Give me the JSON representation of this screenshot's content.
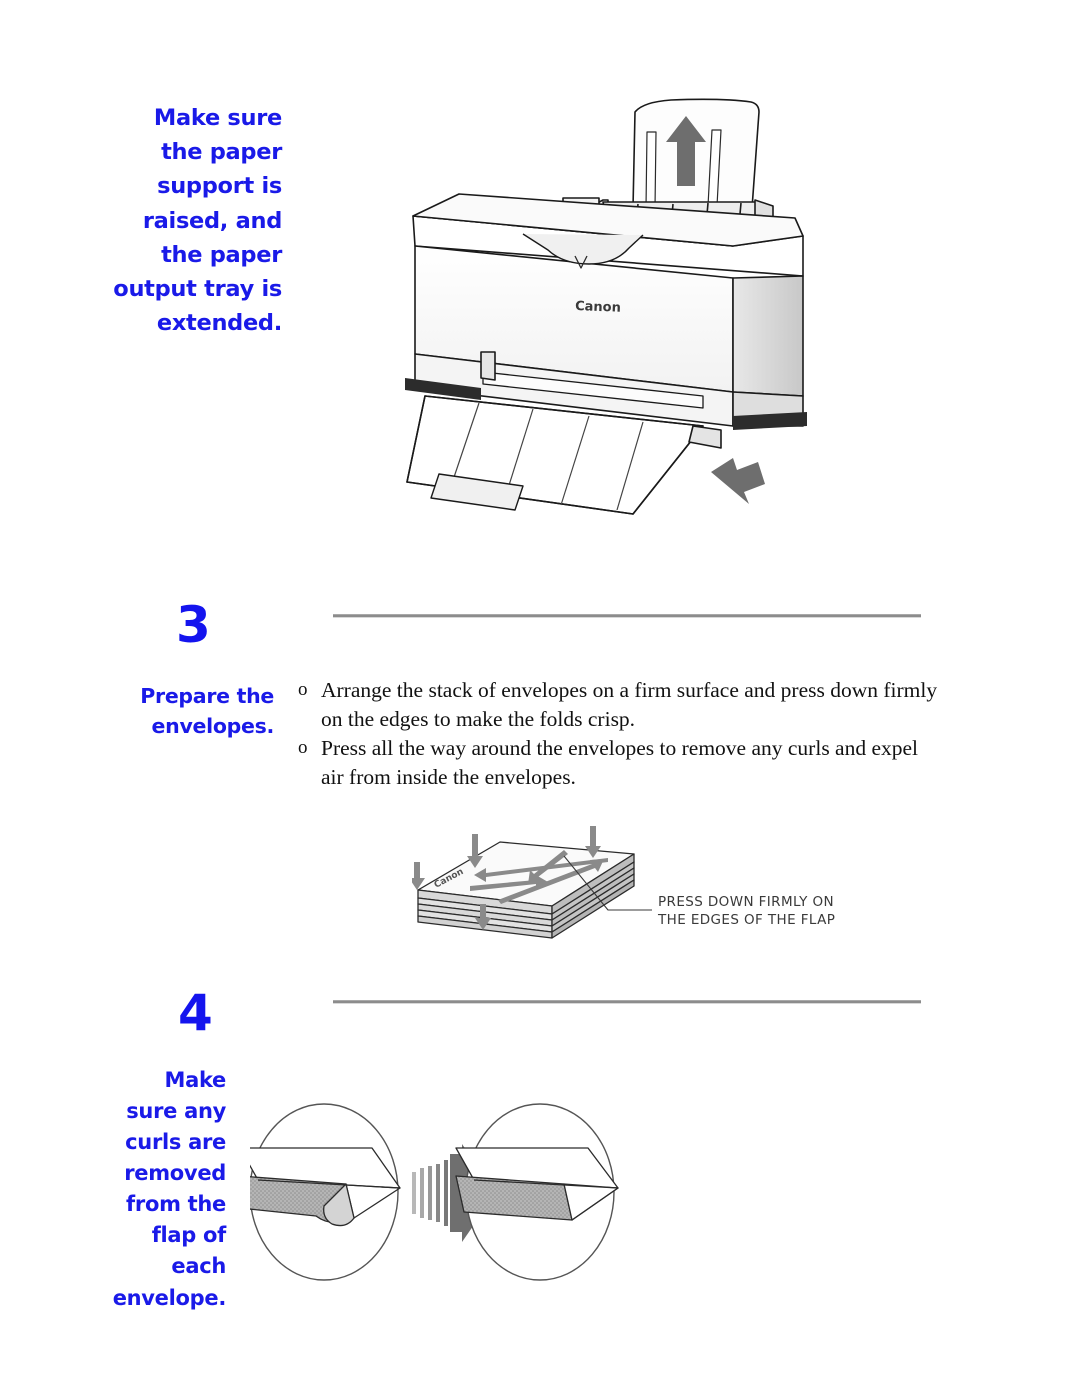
{
  "document": {
    "type": "printer-manual-page",
    "background_color": "#ffffff",
    "accent_color": "#1414EE",
    "rule_color": "#8c8c8c",
    "body_text_color": "#111111"
  },
  "step_two_note": {
    "text": "Make sure\nthe paper\nsupport is\nraised, and\nthe paper\noutput tray is\nextended."
  },
  "printer_illustration": {
    "brand_label": "Canon",
    "alt": "Canon inkjet printer with paper support raised and paper output tray extended",
    "arrow_up_label": "raise paper support",
    "arrow_down_label": "extend output tray"
  },
  "steps": [
    {
      "number": "3",
      "side_note": "Prepare the\nenvelopes.",
      "bullets": [
        {
          "marker": "o",
          "text": "Arrange the stack of envelopes on a firm surface and press down firmly on the edges to make the folds crisp."
        },
        {
          "marker": "o",
          "text": "Press all the way around the envelopes to remove any curls and expel air from inside the envelopes."
        }
      ],
      "illustration": {
        "alt": "Stack of envelopes with arrows indicating press-down directions",
        "brand_label": "Canon",
        "caption_line_1": "PRESS DOWN FIRMLY ON",
        "caption_line_2": "THE EDGES OF THE FLAP"
      }
    },
    {
      "number": "4",
      "side_note": "Make\nsure any\ncurls are\nremoved\nfrom the\nflap of\neach\nenvelope.",
      "illustration": {
        "alt": "Two circular close-up views: curled envelope flap becomes flat after pressing",
        "before_label": "curled flap",
        "after_label": "flat flap"
      }
    }
  ]
}
